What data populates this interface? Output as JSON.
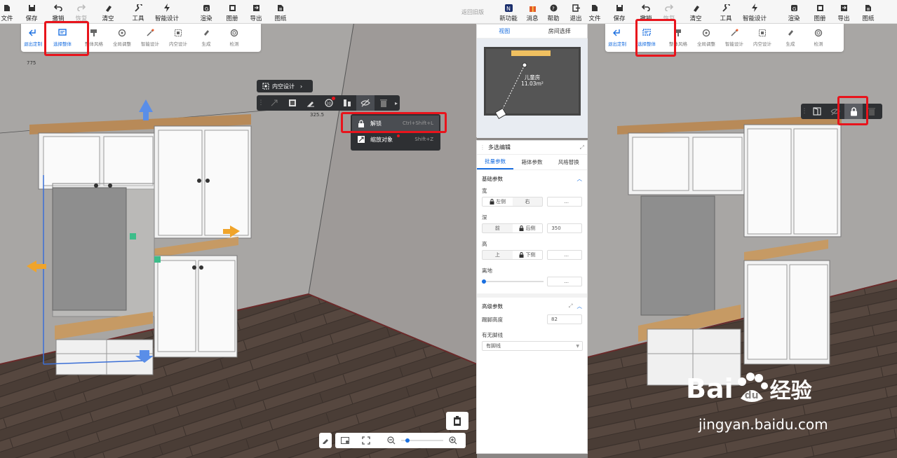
{
  "toolbar": {
    "items": [
      {
        "label": "文件",
        "icon": "file-icon"
      },
      {
        "label": "保存",
        "icon": "save-icon"
      },
      {
        "label": "撤销",
        "icon": "undo-icon"
      },
      {
        "label": "恢复",
        "icon": "redo-icon"
      },
      {
        "label": "清空",
        "icon": "clear-icon"
      },
      {
        "label": "工具",
        "icon": "wrench-icon"
      },
      {
        "label": "智能设计",
        "icon": "lightning-icon"
      },
      {
        "label": "渲染",
        "icon": "render-icon"
      },
      {
        "label": "图册",
        "icon": "album-icon"
      },
      {
        "label": "导出",
        "icon": "export-icon"
      },
      {
        "label": "图纸",
        "icon": "drawing-icon"
      }
    ],
    "right_items": [
      {
        "label": "新功能",
        "icon": "new-feature-icon"
      },
      {
        "label": "消息",
        "icon": "gift-icon"
      },
      {
        "label": "帮助",
        "icon": "help-icon"
      },
      {
        "label": "退出",
        "icon": "exit-icon"
      }
    ],
    "back_link": "返回旧版"
  },
  "subtoolbar": {
    "items": [
      {
        "label": "退出定制",
        "icon": "exit-custom-icon"
      },
      {
        "label": "选择整体",
        "icon": "select-whole-icon"
      },
      {
        "label": "整体风格",
        "icon": "style-icon"
      },
      {
        "label": "全局调整",
        "icon": "global-adjust-icon"
      },
      {
        "label": "智能设计",
        "icon": "smart-design-icon"
      },
      {
        "label": "内空设计",
        "icon": "inner-design-icon"
      },
      {
        "label": "生成",
        "icon": "generate-icon"
      },
      {
        "label": "检测",
        "icon": "detect-icon"
      }
    ]
  },
  "viewport": {
    "dim_775": "775",
    "dim_325": "325.5",
    "inner_design_chip": "内空设计"
  },
  "context_menu": {
    "items": [
      {
        "label": "解锁",
        "shortcut": "Ctrl+Shift+L"
      },
      {
        "label": "缩放对象",
        "shortcut": "Shift+Z"
      }
    ]
  },
  "minimap": {
    "tabs": [
      "视图",
      "房间选择"
    ],
    "room_name": "儿童房",
    "room_area": "11.03m²"
  },
  "multi_edit": {
    "title": "多选编辑",
    "tabs": [
      "批量参数",
      "箱体参数",
      "风格替换"
    ],
    "basic_section": "基础参数",
    "width": {
      "label": "宽",
      "left": "左侧",
      "right": "右",
      "value": "..."
    },
    "depth": {
      "label": "深",
      "front": "前",
      "back": "后侧",
      "value": "350"
    },
    "height": {
      "label": "高",
      "top": "上",
      "bottom": "下侧",
      "value": "..."
    },
    "ground": {
      "label": "离地",
      "value": "..."
    },
    "advanced_section": "高级参数",
    "plinth_height": {
      "label": "踢脚高度",
      "value": "82"
    },
    "has_plinth": {
      "label": "有无脚线",
      "value": "有脚线"
    }
  },
  "watermark": {
    "brand": "Bai",
    "du": "du",
    "jingyan": "经验",
    "url": "jingyan.baidu.com"
  },
  "colors": {
    "accent": "#1a6fe0",
    "highlight": "#e8141c",
    "toolbar_dark": "#2e3033"
  }
}
